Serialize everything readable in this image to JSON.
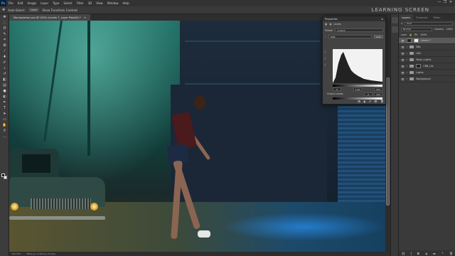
{
  "app": {
    "logo": "Ps",
    "menu": [
      "File",
      "Edit",
      "Image",
      "Layer",
      "Type",
      "Select",
      "Filter",
      "3D",
      "View",
      "Window",
      "Help"
    ],
    "window_controls": [
      "—",
      "❐",
      "✕"
    ]
  },
  "options_bar": {
    "auto_select_label": "Auto-Select:",
    "auto_select_value": "Layer",
    "transform_label": "Show Transform Controls"
  },
  "watermark": "LEARNING SCREEN",
  "document": {
    "tab_title": "Manipulation.psd @ 100% (Levels 7, Layer Mask/8) *",
    "close": "×"
  },
  "status": {
    "zoom": "100.79%",
    "doc_info": "3840 px x 2160 px (72 ppi)"
  },
  "properties": {
    "title": "Properties",
    "panel_type": "Levels",
    "preset_label": "Preset:",
    "preset_value": "Custom",
    "channel_value": "RGB",
    "auto_label": "Auto",
    "input_black": "0",
    "input_gray": "1.00",
    "input_white": "255",
    "output_label": "Output Levels:",
    "output_black": "0",
    "output_white": "255"
  },
  "layers_panel": {
    "tabs": [
      "Layers",
      "Channels",
      "Paths"
    ],
    "filter_label": "Kind",
    "blend_mode": "Normal",
    "opacity_label": "Opacity:",
    "opacity_value": "100%",
    "lock_label": "Lock:",
    "fill_label": "Fill:",
    "fill_value": "100%",
    "layers": [
      {
        "name": "Levels 7",
        "kind": "adjustment",
        "selected": true
      },
      {
        "name": "BBL",
        "kind": "folder",
        "selected": false
      },
      {
        "name": "LBG",
        "kind": "folder",
        "selected": false
      },
      {
        "name": "Moon_Lights",
        "kind": "folder",
        "selected": false
      },
      {
        "name": "CBB_Car",
        "kind": "folder",
        "selected": false
      },
      {
        "name": "Lights",
        "kind": "folder",
        "selected": false
      },
      {
        "name": "Background",
        "kind": "folder",
        "selected": false
      }
    ]
  },
  "colors": {
    "menubar": "#323232",
    "panel": "#3a3a3a",
    "accent": "#31a8ff"
  }
}
